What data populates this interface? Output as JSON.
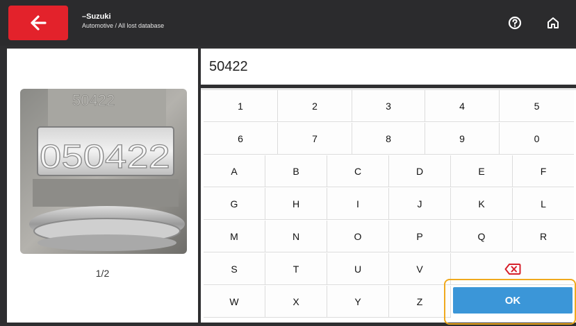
{
  "header": {
    "title": "–Suzuki",
    "subtitle": "Automotive / All lost database",
    "back_icon": "arrow-left-icon",
    "help_icon": "help-circle-icon",
    "home_icon": "home-icon",
    "accent_color": "#e3222b"
  },
  "left_panel": {
    "photo_text_top": "50422",
    "photo_text_plate": "050422",
    "page_indicator": "1/2"
  },
  "input": {
    "value": "50422"
  },
  "keyboard": {
    "rows": [
      [
        "1",
        "2",
        "3",
        "4",
        "5"
      ],
      [
        "6",
        "7",
        "8",
        "9",
        "0"
      ],
      [
        "A",
        "B",
        "C",
        "D",
        "E",
        "F"
      ],
      [
        "G",
        "H",
        "I",
        "J",
        "K",
        "L"
      ],
      [
        "M",
        "N",
        "O",
        "P",
        "Q",
        "R"
      ],
      [
        "S",
        "T",
        "U",
        "V"
      ],
      [
        "W",
        "X",
        "Y",
        "Z"
      ]
    ],
    "backspace_icon": "backspace-icon",
    "ok_label": "OK",
    "ok_color": "#3b96d8",
    "highlight_color": "#f0a91d"
  }
}
